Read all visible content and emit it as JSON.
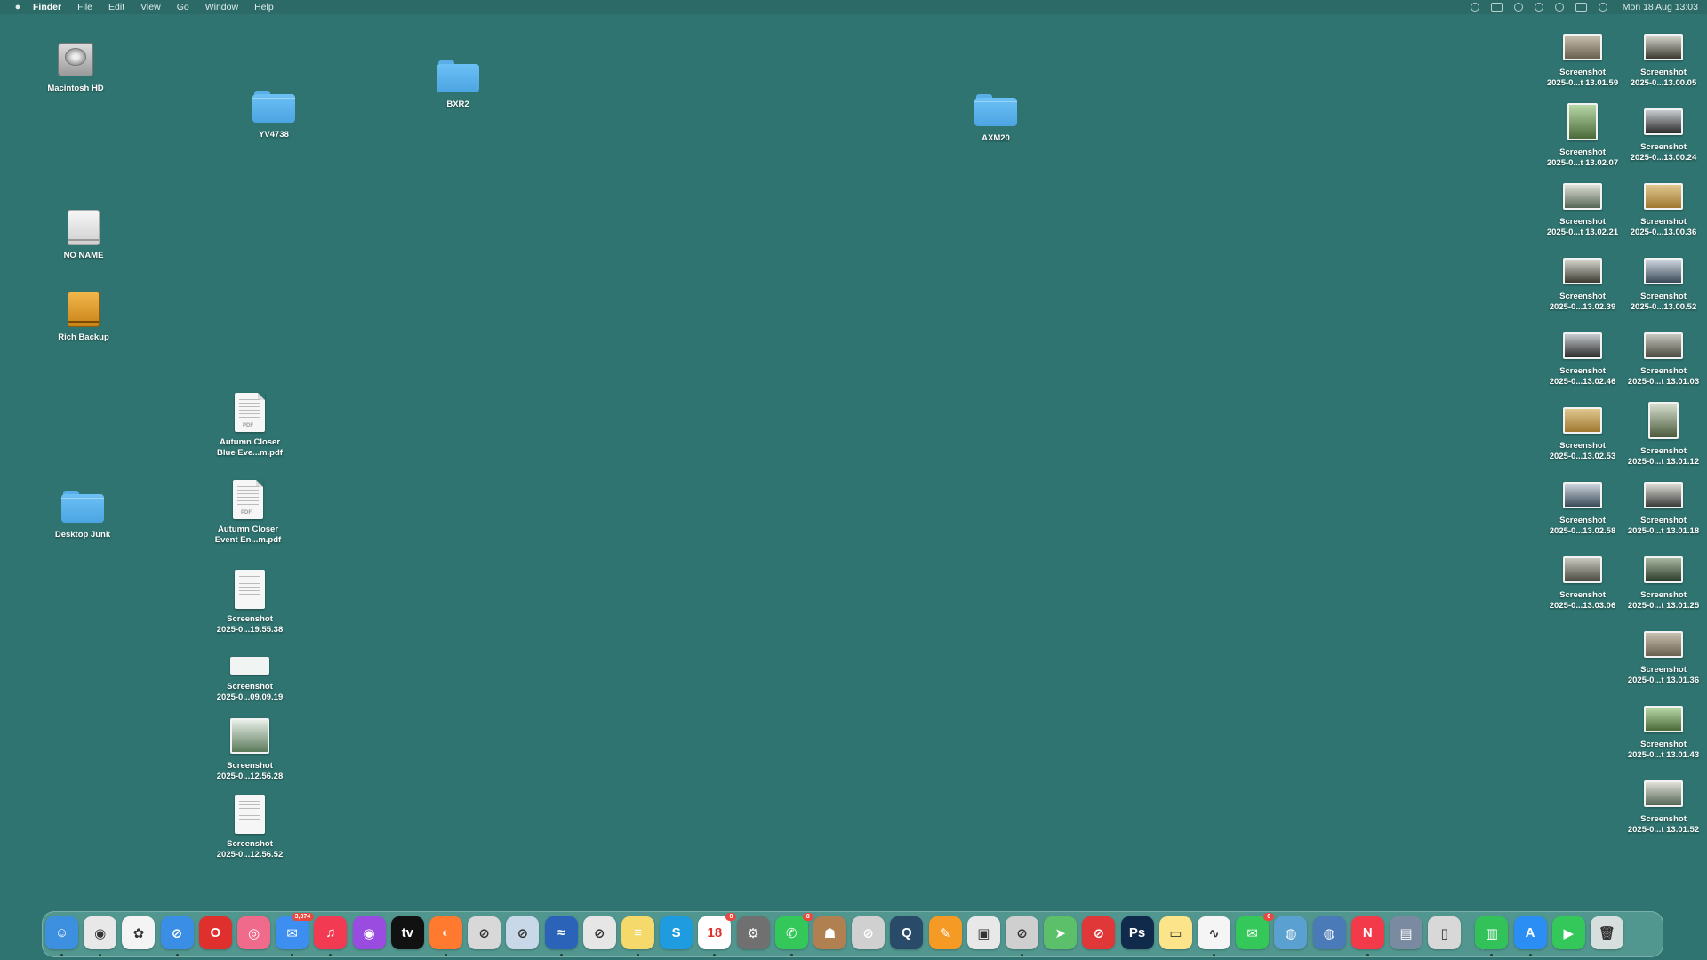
{
  "menubar": {
    "apple_icon": "apple-logo",
    "items": [
      "Finder",
      "File",
      "Edit",
      "View",
      "Go",
      "Window",
      "Help"
    ],
    "status_icons": [
      "creative-cloud-icon",
      "display-icon",
      "wifi-icon",
      "time-machine-icon",
      "search-icon",
      "control-center-icon",
      "siri-icon"
    ],
    "clock": "Mon 18 Aug  13:03"
  },
  "desktop": {
    "volumes": [
      {
        "label": "Macintosh HD",
        "icon": "hard-disk-icon"
      },
      {
        "label": "NO NAME",
        "icon": "external-drive-icon"
      },
      {
        "label": "Rich Backup",
        "icon": "backup-drive-icon"
      }
    ],
    "folders": [
      {
        "label": "YV4738"
      },
      {
        "label": "BXR2"
      },
      {
        "label": "AXM20"
      },
      {
        "label": "Desktop Junk"
      }
    ],
    "files_left": [
      {
        "line1": "Autumn Closer",
        "line2": "Blue Eve...m.pdf"
      },
      {
        "line1": "Autumn Closer",
        "line2": "Event En...m.pdf"
      },
      {
        "line1": "Screenshot",
        "line2": "2025-0...19.55.38"
      },
      {
        "line1": "Screenshot",
        "line2": "2025-0...09.09.19"
      },
      {
        "line1": "Screenshot",
        "line2": "2025-0...12.56.28"
      },
      {
        "line1": "Screenshot",
        "line2": "2025-0...12.56.52"
      }
    ],
    "screenshots_col1": [
      {
        "line1": "Screenshot",
        "line2": "2025-0...t 13.01.59"
      },
      {
        "line1": "Screenshot",
        "line2": "2025-0...t 13.02.07"
      },
      {
        "line1": "Screenshot",
        "line2": "2025-0...t 13.02.21"
      },
      {
        "line1": "Screenshot",
        "line2": "2025-0...13.02.39"
      },
      {
        "line1": "Screenshot",
        "line2": "2025-0...13.02.46"
      },
      {
        "line1": "Screenshot",
        "line2": "2025-0...13.02.53"
      },
      {
        "line1": "Screenshot",
        "line2": "2025-0...13.02.58"
      },
      {
        "line1": "Screenshot",
        "line2": "2025-0...13.03.06"
      }
    ],
    "screenshots_col2": [
      {
        "line1": "Screenshot",
        "line2": "2025-0...13.00.05"
      },
      {
        "line1": "Screenshot",
        "line2": "2025-0...13.00.24"
      },
      {
        "line1": "Screenshot",
        "line2": "2025-0...13.00.36"
      },
      {
        "line1": "Screenshot",
        "line2": "2025-0...13.00.52"
      },
      {
        "line1": "Screenshot",
        "line2": "2025-0...t 13.01.03"
      },
      {
        "line1": "Screenshot",
        "line2": "2025-0...t 13.01.12"
      },
      {
        "line1": "Screenshot",
        "line2": "2025-0...t 13.01.18"
      },
      {
        "line1": "Screenshot",
        "line2": "2025-0...t 13.01.25"
      },
      {
        "line1": "Screenshot",
        "line2": "2025-0...t 13.01.36"
      },
      {
        "line1": "Screenshot",
        "line2": "2025-0...t 13.01.43"
      },
      {
        "line1": "Screenshot",
        "line2": "2025-0...t 13.01.52"
      }
    ]
  },
  "dock": {
    "apps": [
      {
        "name": "finder",
        "glyph": "☺",
        "color": "#3d8fe0"
      },
      {
        "name": "chrome",
        "glyph": "◉",
        "color": "#e8e8e8"
      },
      {
        "name": "photos",
        "glyph": "✿",
        "color": "#f4f4f4"
      },
      {
        "name": "safari",
        "glyph": "⊘",
        "color": "#3a8ee6"
      },
      {
        "name": "opera",
        "glyph": "O",
        "color": "#e0302e"
      },
      {
        "name": "screens",
        "glyph": "◎",
        "color": "#f06a8b"
      },
      {
        "name": "mail",
        "glyph": "✉",
        "color": "#3c8ff0",
        "badge": "3,374"
      },
      {
        "name": "music",
        "glyph": "♫",
        "color": "#f23a52"
      },
      {
        "name": "podcasts",
        "glyph": "◉",
        "color": "#9a4be0"
      },
      {
        "name": "apple-tv",
        "glyph": "tv",
        "color": "#111111"
      },
      {
        "name": "firefox",
        "glyph": "◐",
        "color": "#ff7a2e"
      },
      {
        "name": "app-blocked-1",
        "glyph": "⊘",
        "color": "#d8d8d8"
      },
      {
        "name": "app-blocked-2",
        "glyph": "⊘",
        "color": "#c8d8e8"
      },
      {
        "name": "pilot",
        "glyph": "≈",
        "color": "#2a63b8"
      },
      {
        "name": "app-blocked-3",
        "glyph": "⊘",
        "color": "#e6e6e6"
      },
      {
        "name": "notes",
        "glyph": "≡",
        "color": "#f5d96b"
      },
      {
        "name": "skype",
        "glyph": "S",
        "color": "#1f9be0"
      },
      {
        "name": "calendar",
        "glyph": "18",
        "color": "#ffffff",
        "badge": "8"
      },
      {
        "name": "system-settings",
        "glyph": "⚙",
        "color": "#707070"
      },
      {
        "name": "whatsapp",
        "glyph": "✆",
        "color": "#34c759",
        "badge": "8"
      },
      {
        "name": "contacts",
        "glyph": "☗",
        "color": "#b08050"
      },
      {
        "name": "app-blocked-4",
        "glyph": "⊘",
        "color": "#d0d0d0"
      },
      {
        "name": "quicktime",
        "glyph": "Q",
        "color": "#2a4a6a"
      },
      {
        "name": "pages",
        "glyph": "✎",
        "color": "#f59a25"
      },
      {
        "name": "preview",
        "glyph": "▣",
        "color": "#e8e8e8"
      },
      {
        "name": "app-blocked-5",
        "glyph": "⊘",
        "color": "#cfcfcf"
      },
      {
        "name": "maps",
        "glyph": "➤",
        "color": "#5cbf6a"
      },
      {
        "name": "app-blocked-6",
        "glyph": "⊘",
        "color": "#e03838"
      },
      {
        "name": "photoshop",
        "glyph": "Ps",
        "color": "#0f2a4a"
      },
      {
        "name": "stickies",
        "glyph": "▭",
        "color": "#fbe48a"
      },
      {
        "name": "freeform",
        "glyph": "∿",
        "color": "#f5f5f5"
      },
      {
        "name": "messages",
        "glyph": "✉",
        "color": "#34c759",
        "badge": "6"
      },
      {
        "name": "network-radar",
        "glyph": "◍",
        "color": "#5aa0d0"
      },
      {
        "name": "vpn",
        "glyph": "◍",
        "color": "#4a7ab8"
      },
      {
        "name": "news",
        "glyph": "N",
        "color": "#f23a4a"
      },
      {
        "name": "preview-2",
        "glyph": "▤",
        "color": "#7a8aa0"
      },
      {
        "name": "iphone-mirroring",
        "glyph": "▯",
        "color": "#d8d8d8"
      },
      {
        "name": "numbers",
        "glyph": "▥",
        "color": "#33c15a"
      },
      {
        "name": "app-store",
        "glyph": "A",
        "color": "#2a8ef5"
      },
      {
        "name": "facetime",
        "glyph": "▶",
        "color": "#34c759"
      },
      {
        "name": "trash",
        "glyph": "🗑",
        "color": "#d6dede"
      }
    ]
  }
}
